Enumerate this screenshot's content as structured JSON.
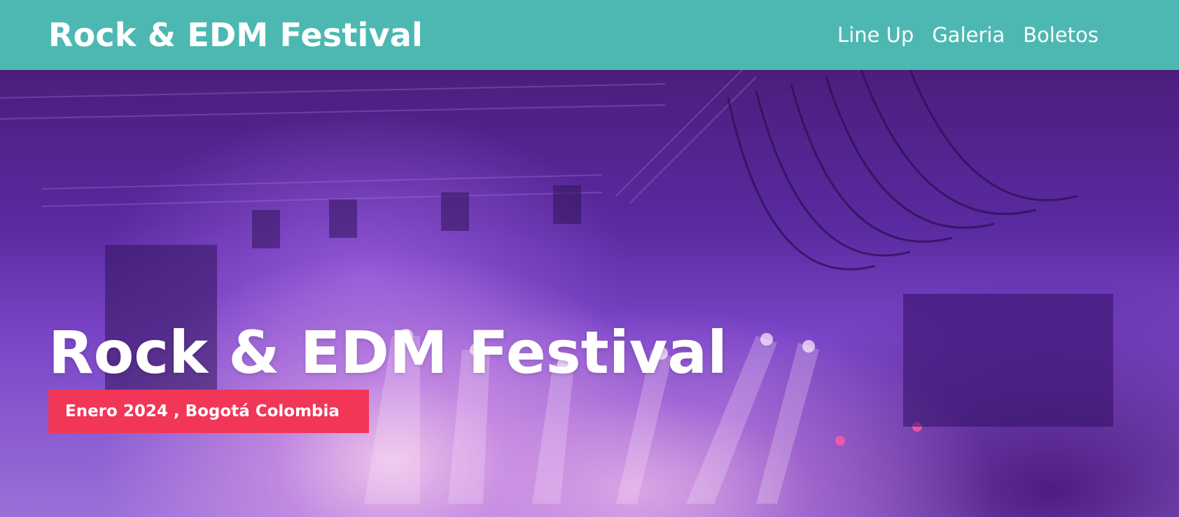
{
  "header": {
    "brand": "Rock & EDM Festival",
    "nav": [
      {
        "label": "Line Up"
      },
      {
        "label": "Galeria"
      },
      {
        "label": "Boletos"
      }
    ]
  },
  "hero": {
    "title": "Rock & EDM Festival",
    "badge": "Enero 2024 , Bogotá Colombia"
  },
  "colors": {
    "header_bg": "#4db8b2",
    "badge_bg": "#f23658",
    "hero_tint": "#6a35b8"
  }
}
